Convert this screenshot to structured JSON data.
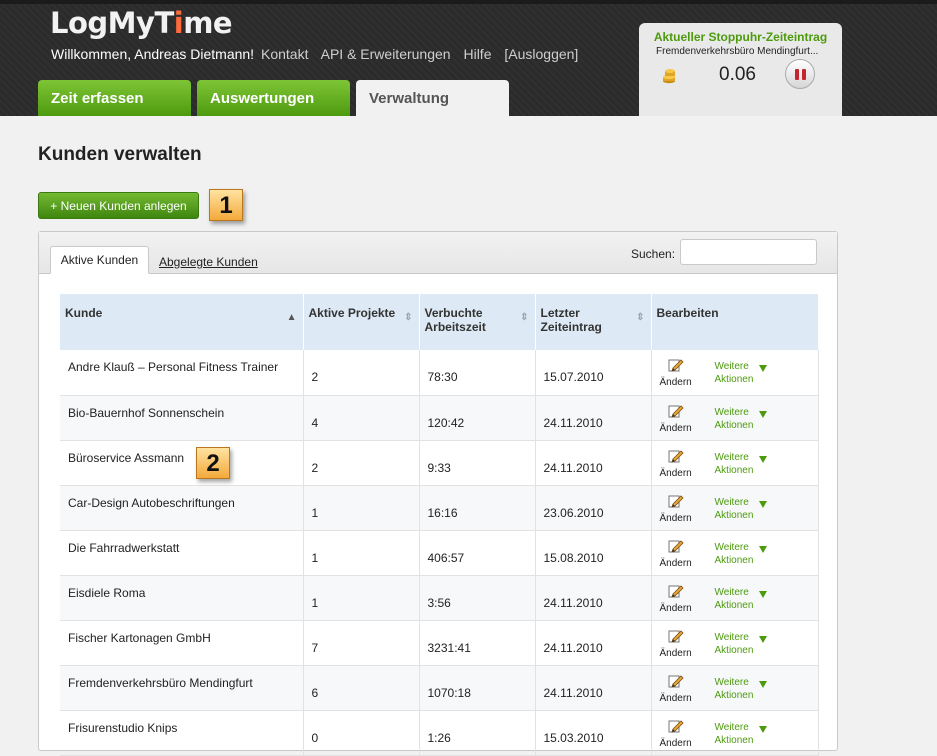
{
  "header": {
    "logo_main": "LogMy",
    "logo_accent_i": "i",
    "logo_end": "me",
    "logo_prefix_t": "T",
    "welcome": "Willkommen, Andreas Dietmann!",
    "links": [
      "Kontakt",
      "API & Erweiterungen",
      "Hilfe",
      "[Ausloggen]"
    ]
  },
  "nav": {
    "tabs": [
      {
        "label": "Zeit erfassen"
      },
      {
        "label": "Auswertungen"
      },
      {
        "label": "Verwaltung"
      }
    ]
  },
  "timer": {
    "title": "Aktueller Stoppuhr-Zeiteintrag",
    "description": "Fremdenverkehrsbüro Mendingfurt...",
    "value": "0.06"
  },
  "page": {
    "title": "Kunden verwalten",
    "new_button": "+ Neuen Kunden anlegen",
    "marker1": "1",
    "marker2": "2"
  },
  "panel": {
    "tab_active": "Aktive Kunden",
    "tab_archived": "Abgelegte Kunden",
    "search_label": "Suchen:",
    "search_value": ""
  },
  "table": {
    "headers": {
      "kunde": "Kunde",
      "projekte": "Aktive Projekte",
      "arbeitszeit_1": "Verbuchte",
      "arbeitszeit_2": "Arbeitszeit",
      "letzter_1": "Letzter",
      "letzter_2": "Zeiteintrag",
      "bearbeiten": "Bearbeiten"
    },
    "edit_label": "Ändern",
    "more_1": "Weitere",
    "more_2": "Aktionen",
    "rows": [
      {
        "name": "Andre Klauß – Personal Fitness Trainer",
        "projects": "2",
        "time": "78:30",
        "last": "15.07.2010"
      },
      {
        "name": "Bio-Bauernhof Sonnenschein",
        "projects": "4",
        "time": "120:42",
        "last": "24.11.2010"
      },
      {
        "name": "Büroservice Assmann",
        "projects": "2",
        "time": "9:33",
        "last": "24.11.2010"
      },
      {
        "name": "Car-Design Autobeschriftungen",
        "projects": "1",
        "time": "16:16",
        "last": "23.06.2010"
      },
      {
        "name": "Die Fahrradwerkstatt",
        "projects": "1",
        "time": "406:57",
        "last": "15.08.2010"
      },
      {
        "name": "Eisdiele Roma",
        "projects": "1",
        "time": "3:56",
        "last": "24.11.2010"
      },
      {
        "name": "Fischer Kartonagen GmbH",
        "projects": "7",
        "time": "3231:41",
        "last": "24.11.2010"
      },
      {
        "name": "Fremdenverkehrsbüro Mendingfurt",
        "projects": "6",
        "time": "1070:18",
        "last": "24.11.2010"
      },
      {
        "name": "Frisurenstudio Knips",
        "projects": "0",
        "time": "1:26",
        "last": "15.03.2010"
      }
    ]
  },
  "colors": {
    "accent_green": "#4e9a0f",
    "header_bg": "#2b2b2b",
    "table_header_bg": "#dde9f4",
    "marker": "#f3a93b"
  }
}
